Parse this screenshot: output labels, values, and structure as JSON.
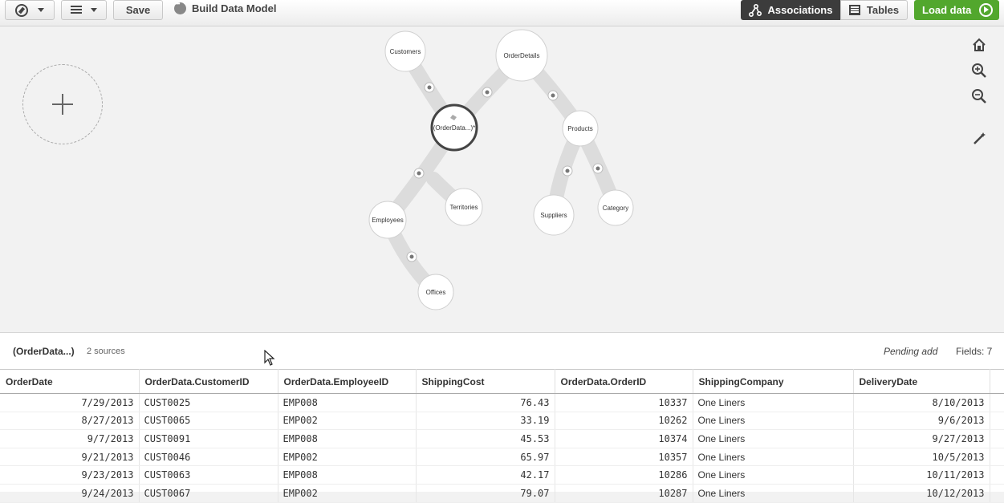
{
  "toolbar": {
    "save_label": "Save",
    "app_title": "Build Data Model",
    "associations_label": "Associations",
    "tables_label": "Tables",
    "load_label": "Load data"
  },
  "graph": {
    "nodes": [
      {
        "id": "customers",
        "label": "Customers"
      },
      {
        "id": "orderdetails",
        "label": "OrderDetails"
      },
      {
        "id": "orderdata",
        "label": "(OrderData...)*"
      },
      {
        "id": "products",
        "label": "Products"
      },
      {
        "id": "employees",
        "label": "Employees"
      },
      {
        "id": "territories",
        "label": "Territories"
      },
      {
        "id": "suppliers",
        "label": "Suppliers"
      },
      {
        "id": "category",
        "label": "Category"
      },
      {
        "id": "offices",
        "label": "Offices"
      }
    ]
  },
  "info": {
    "table_name": "(OrderData...)",
    "sources": "2 sources",
    "status": "Pending add",
    "fields": "Fields: 7"
  },
  "table": {
    "columns": [
      "OrderDate",
      "OrderData.CustomerID",
      "OrderData.EmployeeID",
      "ShippingCost",
      "OrderData.OrderID",
      "ShippingCompany",
      "DeliveryDate"
    ],
    "rows": [
      [
        "7/29/2013",
        "CUST0025",
        "EMP008",
        "76.43",
        "10337",
        "One Liners",
        "8/10/2013"
      ],
      [
        "8/27/2013",
        "CUST0065",
        "EMP002",
        "33.19",
        "10262",
        "One Liners",
        "9/6/2013"
      ],
      [
        "9/7/2013",
        "CUST0091",
        "EMP008",
        "45.53",
        "10374",
        "One Liners",
        "9/27/2013"
      ],
      [
        "9/21/2013",
        "CUST0046",
        "EMP002",
        "65.97",
        "10357",
        "One Liners",
        "10/5/2013"
      ],
      [
        "9/23/2013",
        "CUST0063",
        "EMP008",
        "42.17",
        "10286",
        "One Liners",
        "10/11/2013"
      ],
      [
        "9/24/2013",
        "CUST0067",
        "EMP002",
        "79.07",
        "10287",
        "One Liners",
        "10/12/2013"
      ]
    ]
  }
}
